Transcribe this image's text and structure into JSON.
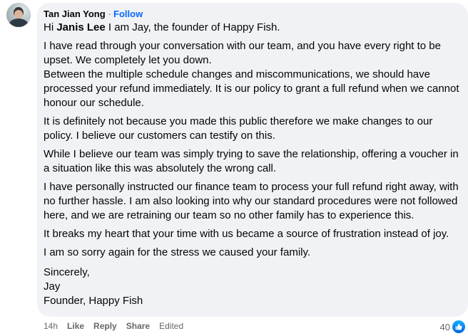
{
  "comment": {
    "author": "Tan Jian Yong",
    "separator": "·",
    "follow_label": "Follow",
    "greeting_prefix": "Hi",
    "mention": "Janis Lee",
    "greeting_suffix": "I am Jay, the founder of Happy Fish.",
    "paragraphs": [
      "I have read through your conversation with our team, and you have every right to be upset. We completely let you down.",
      "Between the multiple schedule changes and miscommunications, we should have processed your refund immediately. It is our policy to grant a full refund when we cannot honour our schedule.",
      "It is definitely not because you made this public therefore we make changes to our policy. I believe our customers can testify on this.",
      "While I believe our team was simply trying to save the relationship, offering a voucher in a situation like this was absolutely the wrong call.",
      "I have personally instructed our finance team to process your full refund right away, with no further hassle. I am also looking into why our standard procedures were not followed here, and we are retraining our team so no other family has to experience this.",
      "It breaks my heart that your time with us became a source of frustration instead of joy.",
      "I am so sorry again for the stress we caused your family."
    ],
    "signoff": [
      "Sincerely,",
      "Jay",
      "Founder, Happy Fish"
    ]
  },
  "actions": {
    "time": "14h",
    "like": "Like",
    "reply": "Reply",
    "share": "Share",
    "edited": "Edited"
  },
  "reactions": {
    "count": "40",
    "icon": "like-thumb-icon",
    "color": "#0866ff"
  }
}
